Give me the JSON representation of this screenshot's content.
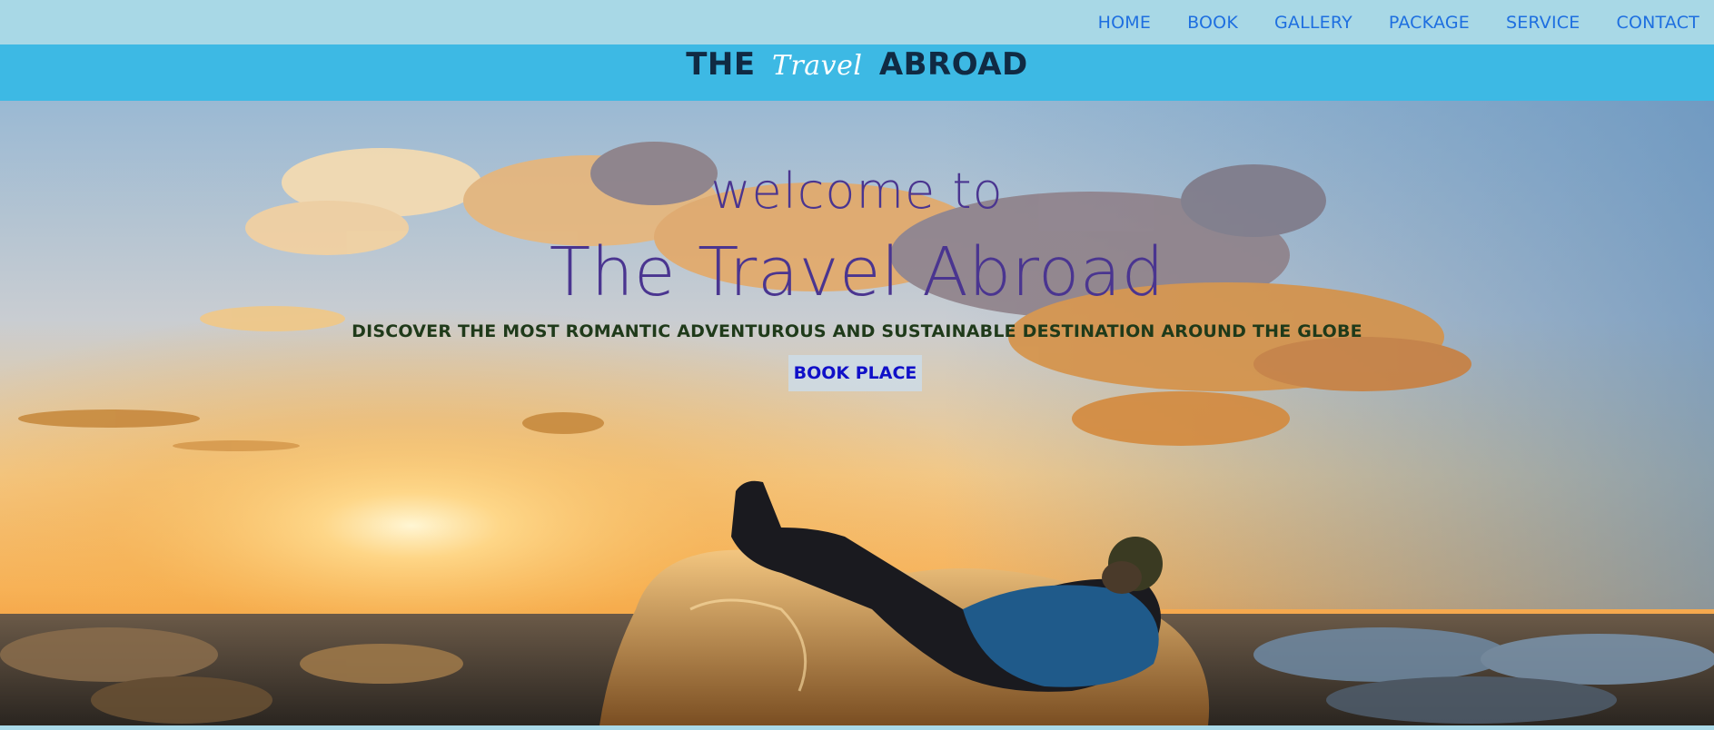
{
  "nav": {
    "items": [
      {
        "label": "HOME"
      },
      {
        "label": "BOOK"
      },
      {
        "label": "GALLERY"
      },
      {
        "label": "PACKAGE"
      },
      {
        "label": "SERVICE"
      },
      {
        "label": "CONTACT"
      }
    ]
  },
  "brand": {
    "part1": "THE",
    "script": "Travel",
    "part2": "ABROAD"
  },
  "hero": {
    "welcome": "welcome to",
    "title": "The Travel Abroad",
    "tagline": "DISCOVER THE MOST ROMANTIC ADVENTUROUS AND SUSTAINABLE DESTINATION AROUND THE GLOBE",
    "button_label": "BOOK PLACE"
  },
  "colors": {
    "nav_bg": "#a8d8e6",
    "brand_bg": "#3db9e4",
    "nav_link": "#1e6fe0",
    "hero_text": "#4a3590",
    "button_text": "#1010c8"
  }
}
